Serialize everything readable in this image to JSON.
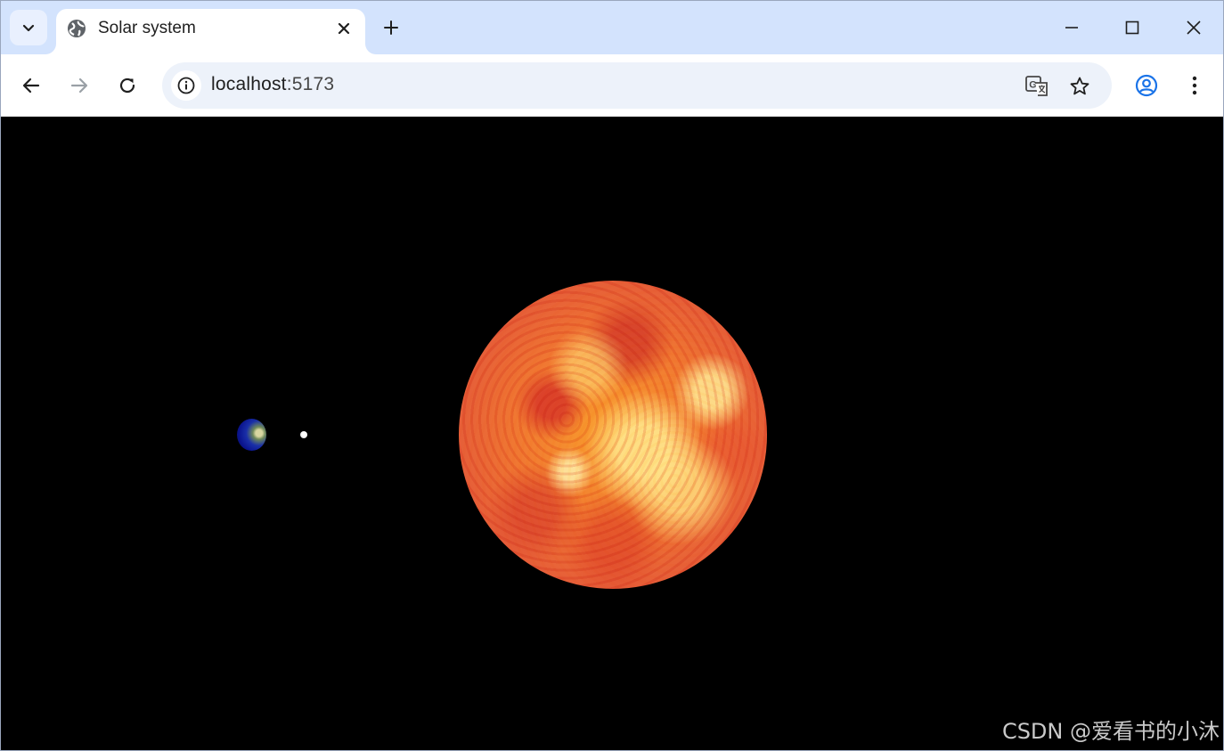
{
  "browser": {
    "tab": {
      "title": "Solar system",
      "favicon": "globe-icon",
      "close_icon": "close-icon"
    },
    "new_tab_icon": "plus-icon",
    "window_controls": [
      "minimize-icon",
      "maximize-icon",
      "close-icon"
    ],
    "toolbar": {
      "back_icon": "arrow-left-icon",
      "forward_icon": "arrow-right-icon",
      "reload_icon": "reload-icon",
      "site_info_icon": "info-icon",
      "url_host": "localhost",
      "url_port": ":5173",
      "translate_icon": "translate-icon",
      "bookmark_icon": "star-icon",
      "profile_icon": "profile-icon",
      "menu_icon": "kebab-menu-icon"
    }
  },
  "page": {
    "scene": {
      "background": "#000000",
      "bodies": [
        "sun",
        "earth",
        "moon"
      ]
    },
    "watermark": "CSDN @爱看书的小沐"
  }
}
